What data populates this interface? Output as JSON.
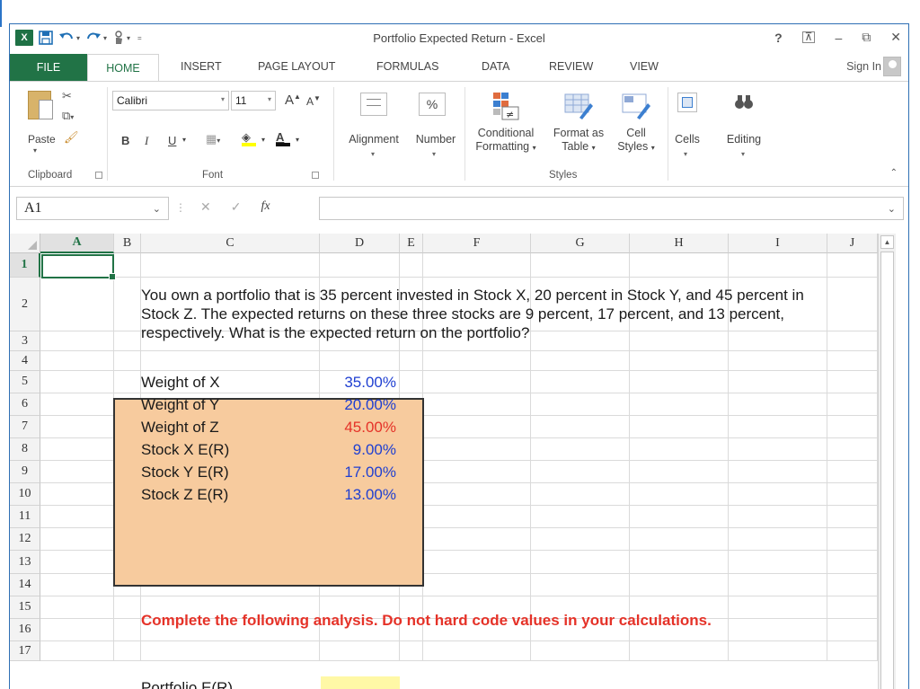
{
  "window": {
    "title": "Portfolio Expected Return - Excel"
  },
  "qat": {
    "app_icon": "X",
    "icons": [
      "excel-icon",
      "save-icon",
      "undo-icon",
      "redo-icon",
      "touch-mode-icon",
      "customize-icon"
    ]
  },
  "window_controls": {
    "help": "?",
    "ribbon_display": "⊼",
    "minimize": "–",
    "restore": "⧉",
    "close": "✕"
  },
  "tabs": {
    "file": "FILE",
    "home": "HOME",
    "insert": "INSERT",
    "page_layout": "PAGE LAYOUT",
    "formulas": "FORMULAS",
    "data": "DATA",
    "review": "REVIEW",
    "view": "VIEW",
    "sign_in": "Sign In"
  },
  "ribbon": {
    "clipboard": {
      "paste": "Paste",
      "group": "Clipboard"
    },
    "font": {
      "family": "Calibri",
      "size": "11",
      "grow": "A",
      "shrink": "A",
      "bold": "B",
      "italic": "I",
      "underline": "U",
      "font_color": "A",
      "group": "Font"
    },
    "alignment": {
      "label": "Alignment"
    },
    "number": {
      "label": "Number",
      "percent": "%"
    },
    "styles": {
      "conditional_1": "Conditional",
      "conditional_2": "Formatting",
      "format_table_1": "Format as",
      "format_table_2": "Table",
      "cell_styles_1": "Cell",
      "cell_styles_2": "Styles",
      "group": "Styles"
    },
    "cells": {
      "label": "Cells"
    },
    "editing": {
      "label": "Editing"
    }
  },
  "formula_bar": {
    "name_box": "A1",
    "cancel": "✕",
    "enter": "✓",
    "fx": "fx",
    "content": ""
  },
  "columns": [
    "A",
    "B",
    "C",
    "D",
    "E",
    "F",
    "G",
    "H",
    "I",
    "J"
  ],
  "rows": [
    "1",
    "2",
    "3",
    "4",
    "5",
    "6",
    "7",
    "8",
    "9",
    "10",
    "11",
    "12",
    "13",
    "14",
    "15",
    "16",
    "17"
  ],
  "sheet": {
    "problem": "You own a portfolio that is 35 percent invested in Stock X, 20 percent in Stock Y, and 45 percent in Stock Z. The expected returns on these three stocks are 9 percent, 17 percent, and 13 percent, respectively. What is the expected return on the portfolio?",
    "inputs": [
      {
        "label": "Weight of X",
        "value": "35.00%",
        "color": "#1f3fd1"
      },
      {
        "label": "Weight of Y",
        "value": "20.00%",
        "color": "#1f3fd1"
      },
      {
        "label": "Weight of Z",
        "value": "45.00%",
        "color": "#e53228"
      },
      {
        "label": "Stock X E(R)",
        "value": "9.00%",
        "color": "#1f3fd1"
      },
      {
        "label": "Stock Y E(R)",
        "value": "17.00%",
        "color": "#1f3fd1"
      },
      {
        "label": "Stock Z E(R)",
        "value": "13.00%",
        "color": "#1f3fd1"
      }
    ],
    "instruction": "Complete the following analysis. Do not hard code values in your calculations.",
    "portfolio_label": "Portfolio E(R)",
    "portfolio_value": ""
  },
  "colors": {
    "excel_green": "#217346",
    "input_box": "#f7cb9e",
    "answer_cell": "#fff8a6",
    "instruction_red": "#e53228",
    "input_blue": "#1f3fd1"
  }
}
